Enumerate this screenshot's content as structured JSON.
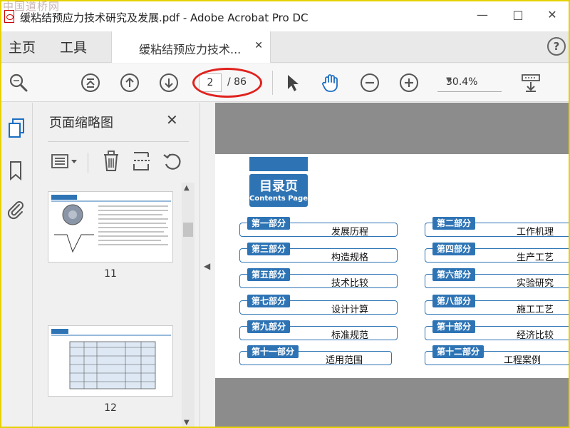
{
  "window": {
    "watermark": "中国道桥网",
    "title": "缓粘结预应力技术研究及发展.pdf - Adobe Acrobat Pro DC"
  },
  "tabs": {
    "home": "主页",
    "tools": "工具",
    "document": "缓粘结预应力技术...",
    "help": "?"
  },
  "toolbar": {
    "page_current": "2",
    "page_total": "/ 86",
    "zoom": "30.4%"
  },
  "panel": {
    "title": "页面缩略图",
    "thumbnails": [
      {
        "page": "11",
        "header": "第三部分 构造规格"
      },
      {
        "page": "12",
        "header": "第三部分 构造规格"
      }
    ]
  },
  "toc": {
    "title_cn": "目录页",
    "title_en": "Contents Page",
    "items": [
      {
        "num": "第一部分",
        "name": "发展历程"
      },
      {
        "num": "第二部分",
        "name": "工作机理"
      },
      {
        "num": "第三部分",
        "name": "构造规格"
      },
      {
        "num": "第四部分",
        "name": "生产工艺"
      },
      {
        "num": "第五部分",
        "name": "技术比较"
      },
      {
        "num": "第六部分",
        "name": "实验研究"
      },
      {
        "num": "第七部分",
        "name": "设计计算"
      },
      {
        "num": "第八部分",
        "name": "施工工艺"
      },
      {
        "num": "第九部分",
        "name": "标准规范"
      },
      {
        "num": "第十部分",
        "name": "经济比较"
      },
      {
        "num": "第十一部分",
        "name": "适用范围"
      },
      {
        "num": "第十二部分",
        "name": "工程案例"
      }
    ]
  },
  "colors": {
    "accent": "#2e74b5",
    "highlight": "#e0221e",
    "frame": "#e6d200"
  }
}
